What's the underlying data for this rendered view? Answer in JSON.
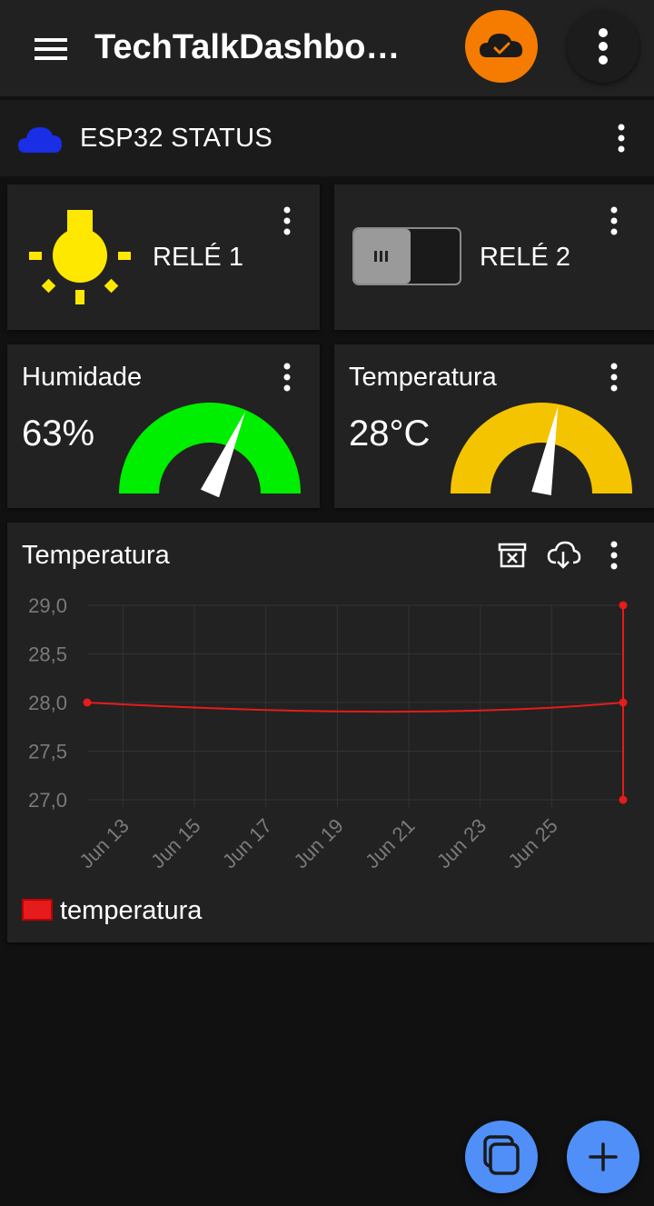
{
  "app": {
    "title": "TechTalkDashbo…",
    "menu_icon": "hamburger-menu-icon",
    "cloud_status_icon": "cloud-check-icon",
    "overflow_icon": "vertical-dots-icon",
    "accent_color": "#f57c00"
  },
  "section": {
    "title": "ESP32 STATUS",
    "icon": "cloud-icon",
    "icon_color": "#1a2ee6"
  },
  "widgets": {
    "relay1": {
      "label": "RELÉ 1",
      "icon": "lightbulb-icon",
      "state": "on",
      "color": "#ffe800"
    },
    "relay2": {
      "label": "RELÉ 2",
      "icon": "toggle-switch-icon",
      "state": "off"
    },
    "humidity": {
      "label": "Humidade",
      "value": "63%",
      "level": 63,
      "color": "#00ee00"
    },
    "temperature": {
      "label": "Temperatura",
      "value": "28°C",
      "level": 28,
      "color": "#f5c400"
    }
  },
  "chart_card": {
    "title": "Temperatura",
    "clear_icon": "archive-clear-icon",
    "download_icon": "cloud-download-icon",
    "menu_icon": "vertical-dots-icon"
  },
  "chart_data": {
    "type": "line",
    "title": "Temperatura",
    "x_ticks": [
      "Jun 13",
      "Jun 15",
      "Jun 17",
      "Jun 19",
      "Jun 21",
      "Jun 23",
      "Jun 25"
    ],
    "y_ticks": [
      "29,0",
      "28,5",
      "28,0",
      "27,5",
      "27,0"
    ],
    "ylim": [
      27.0,
      29.0
    ],
    "series": [
      {
        "name": "temperatura",
        "color": "#e61b1b",
        "points": [
          {
            "x": "Jun 12",
            "y": 28.0
          },
          {
            "x": "Jun 27",
            "y": 29.0
          },
          {
            "x": "Jun 27",
            "y": 28.0
          },
          {
            "x": "Jun 27",
            "y": 27.0
          }
        ]
      }
    ],
    "grid": true,
    "legend": "bottom-left"
  },
  "fabs": {
    "copy_icon": "copy-icon",
    "add_icon": "plus-icon"
  }
}
